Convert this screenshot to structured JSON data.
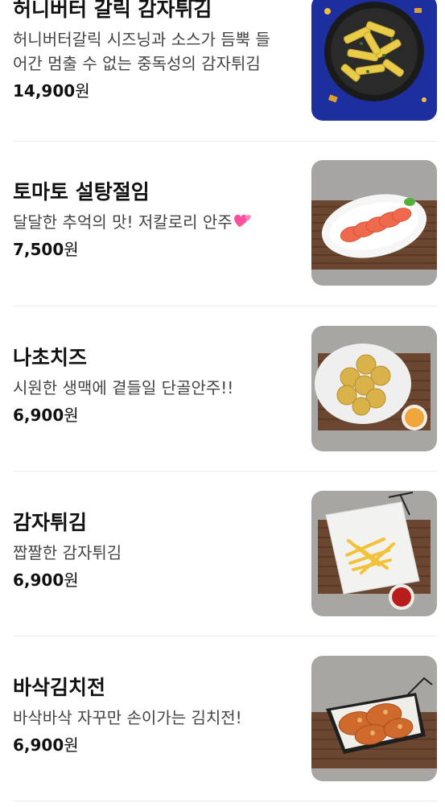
{
  "menu": {
    "items": [
      {
        "name": "허니버터 갈릭 감자튀김",
        "desc_line1": "허니버터갈릭 시즈닝과 소스가 듬뿍 들",
        "desc_line2": "어간 멈출 수 없는 중독성의 감자튀김",
        "price": "14,900",
        "currency": "원",
        "image_icon": "honey-butter-garlic-fries-photo"
      },
      {
        "name": "토마토 설탕절임",
        "desc_line1": "달달한 추억의 맛! 저칼로리 안주",
        "price": "7,500",
        "currency": "원",
        "image_icon": "sugared-tomato-photo"
      },
      {
        "name": "나초치즈",
        "desc_line1": "시원한 생맥에 곁들일 단골안주!!",
        "price": "6,900",
        "currency": "원",
        "image_icon": "nacho-cheese-photo"
      },
      {
        "name": "감자튀김",
        "desc_line1": "짭짤한 감자튀김",
        "price": "6,900",
        "currency": "원",
        "image_icon": "french-fries-photo"
      },
      {
        "name": "바삭김치전",
        "desc_line1": "바삭바삭 자꾸만 손이가는 김치전!",
        "price": "6,900",
        "currency": "원",
        "image_icon": "kimchi-pancake-photo"
      }
    ]
  },
  "colors": {
    "text_primary": "#111111",
    "text_secondary": "#444444",
    "divider": "#ececec"
  }
}
